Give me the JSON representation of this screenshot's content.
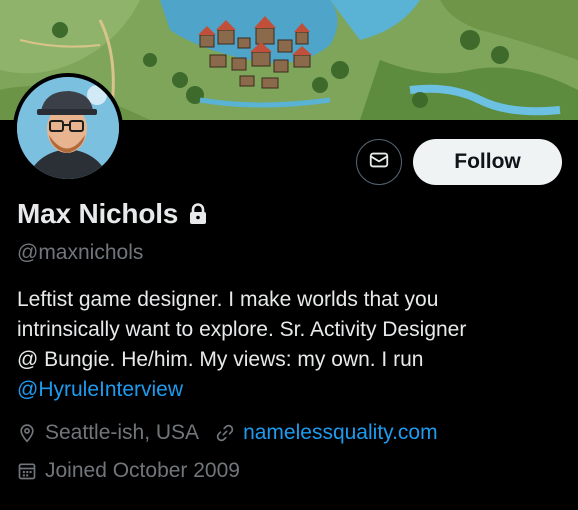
{
  "profile": {
    "display_name": "Max Nichols",
    "handle": "@maxnichols",
    "bio_lines": [
      "Leftist game designer. I make worlds that you",
      "intrinsically want to explore. Sr. Activity Designer",
      "@ Bungie. He/him. My views: my own. I run"
    ],
    "bio_mention": "@HyruleInterview",
    "location": "Seattle-ish, USA",
    "website": "namelessquality.com",
    "joined": "Joined October 2009"
  },
  "actions": {
    "follow_label": "Follow"
  },
  "icons": {
    "message": "envelope-icon",
    "protected": "lock-icon",
    "location": "location-pin-icon",
    "website": "link-icon",
    "joined": "calendar-icon"
  },
  "colors": {
    "background": "#000000",
    "text_primary": "#e7e9ea",
    "text_secondary": "#71767b",
    "link": "#1d9bf0",
    "follow_bg": "#eff3f4"
  }
}
